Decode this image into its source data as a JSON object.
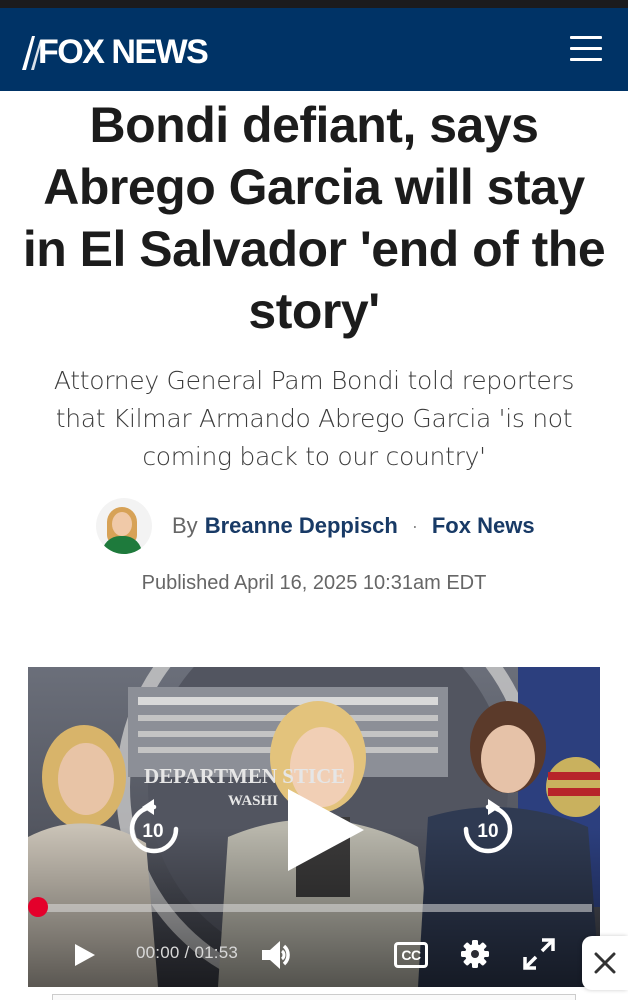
{
  "header": {
    "logo_text": "FOX NEWS",
    "menu_icon": "hamburger-menu-icon",
    "background": "#003366"
  },
  "article": {
    "headline": "Bondi defiant, says Abrego Garcia will stay in El Salvador 'end of the story'",
    "subheadline": "Attorney General Pam Bondi told reporters that Kilmar Armando Abrego Garcia 'is not coming back to our country'",
    "byline": {
      "prefix": "By",
      "author": "Breanne Deppisch",
      "separator": "·",
      "outlet": "Fox News"
    },
    "published": "Published April 16, 2025 10:31am EDT"
  },
  "video": {
    "backdrop_text_line1": "DEPARTMEN    STICE",
    "backdrop_text_line2": "WASHI",
    "rewind_seconds": "10",
    "forward_seconds": "10",
    "current_time": "00:00",
    "time_separator": "/",
    "duration": "01:53",
    "progress": 0,
    "cc_label": "CC",
    "accent": "#e4002b",
    "icons": [
      "play-icon",
      "rewind-10-icon",
      "forward-10-icon",
      "volume-icon",
      "closed-captions-icon",
      "settings-gear-icon",
      "fullscreen-icon"
    ]
  },
  "overlay": {
    "close_icon": "close-icon"
  }
}
